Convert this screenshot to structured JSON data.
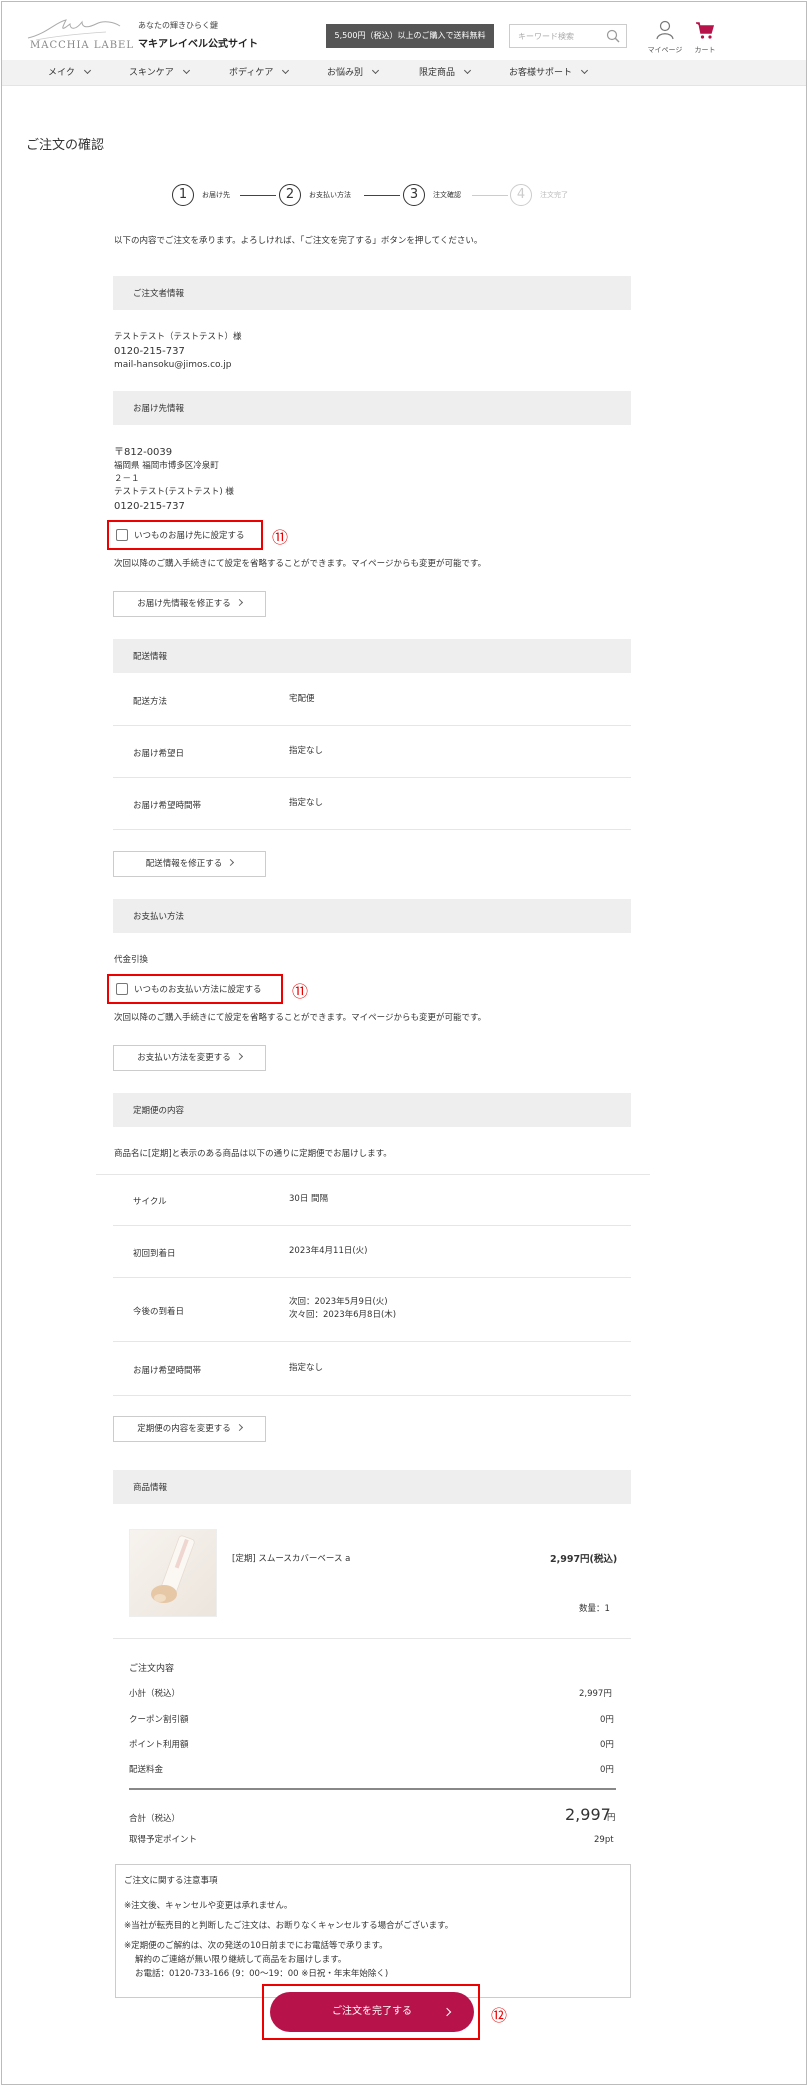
{
  "header": {
    "logo_text": "MACCHIA LABEL",
    "tagline": "あなたの輝きひらく鍵",
    "site_name": "マキアレイベル公式サイト",
    "shipping_banner": "5,500円（税込）以上のご購入で送料無料",
    "search_placeholder": "キーワード検索",
    "mypage_label": "マイページ",
    "cart_label": "カート",
    "accent_color": "#b8124a"
  },
  "nav": [
    "メイク",
    "スキンケア",
    "ボディケア",
    "お悩み別",
    "限定商品",
    "お客様サポート"
  ],
  "page_title": "ご注文の確認",
  "steps": [
    {
      "num": "1",
      "label": "お届け先"
    },
    {
      "num": "2",
      "label": "お支払い方法"
    },
    {
      "num": "3",
      "label": "注文確認"
    },
    {
      "num": "4",
      "label": "注文完了"
    }
  ],
  "intro": "以下の内容でご注文を承ります。よろしければ、「ご注文を完了する」ボタンを押してください。",
  "orderer": {
    "heading": "ご注文者情報",
    "name": "テストテスト（テストテスト）様",
    "phone": "0120-215-737",
    "email": "mail-hansoku@jimos.co.jp"
  },
  "delivery": {
    "heading": "お届け先情報",
    "postal": "〒812-0039",
    "address": "福岡県 福岡市博多区冷泉町",
    "address2": "２－１",
    "name": "テストテスト(テストテスト) 様",
    "phone": "0120-215-737",
    "checkbox_label": "いつものお届け先に設定する",
    "annotation": "⑪",
    "note": "次回以降のご購入手続きにて設定を省略することができます。マイページからも変更が可能です。",
    "edit_button": "お届け先情報を修正する"
  },
  "shipping": {
    "heading": "配送情報",
    "rows": [
      {
        "label": "配送方法",
        "value": "宅配便"
      },
      {
        "label": "お届け希望日",
        "value": "指定なし"
      },
      {
        "label": "お届け希望時間帯",
        "value": "指定なし"
      }
    ],
    "edit_button": "配送情報を修正する"
  },
  "payment": {
    "heading": "お支払い方法",
    "method": "代金引換",
    "checkbox_label": "いつものお支払い方法に設定する",
    "annotation": "⑪",
    "note": "次回以降のご購入手続きにて設定を省略することができます。マイページからも変更が可能です。",
    "edit_button": "お支払い方法を変更する"
  },
  "subscription": {
    "heading": "定期便の内容",
    "note": "商品名に[定期]と表示のある商品は以下の通りに定期便でお届けします。",
    "rows": [
      {
        "label": "サイクル",
        "value": "30日 間隔"
      },
      {
        "label": "初回到着日",
        "value": "2023年4月11日(火)"
      },
      {
        "label": "今後の到着日",
        "value": "次回：2023年5月9日(火)",
        "value2": "次々回：2023年6月8日(木)"
      },
      {
        "label": "お届け希望時間帯",
        "value": "指定なし"
      }
    ],
    "edit_button": "定期便の内容を変更する"
  },
  "product": {
    "heading": "商品情報",
    "name": "[定期] スムースカバーベース a",
    "price": "2,997円(税込)",
    "quantity": "数量：1"
  },
  "summary": {
    "heading": "ご注文内容",
    "rows": [
      {
        "label": "小計（税込）",
        "value": "2,997円"
      },
      {
        "label": "クーポン割引額",
        "value": "0円"
      },
      {
        "label": "ポイント利用額",
        "value": "0円"
      },
      {
        "label": "配送料金",
        "value": "0円"
      }
    ],
    "total_label": "合計（税込）",
    "total_value": "2,997",
    "total_unit": "円",
    "points_label": "取得予定ポイント",
    "points_value": "29pt"
  },
  "notice": {
    "heading": "ご注文に関する注意事項",
    "lines": [
      "※注文後、キャンセルや変更は承れません。",
      "※当社が転売目的と判断したご注文は、お断りなくキャンセルする場合がございます。",
      "※定期便のご解約は、次の発送の10日前までにお電話等で承ります。",
      "解約のご連絡が無い限り継続して商品をお届けします。",
      "お電話：0120-733-166 (9：00〜19：00 ※日祝・年末年始除く)"
    ]
  },
  "complete_button": "ご注文を完了する",
  "complete_annotation": "⑫"
}
